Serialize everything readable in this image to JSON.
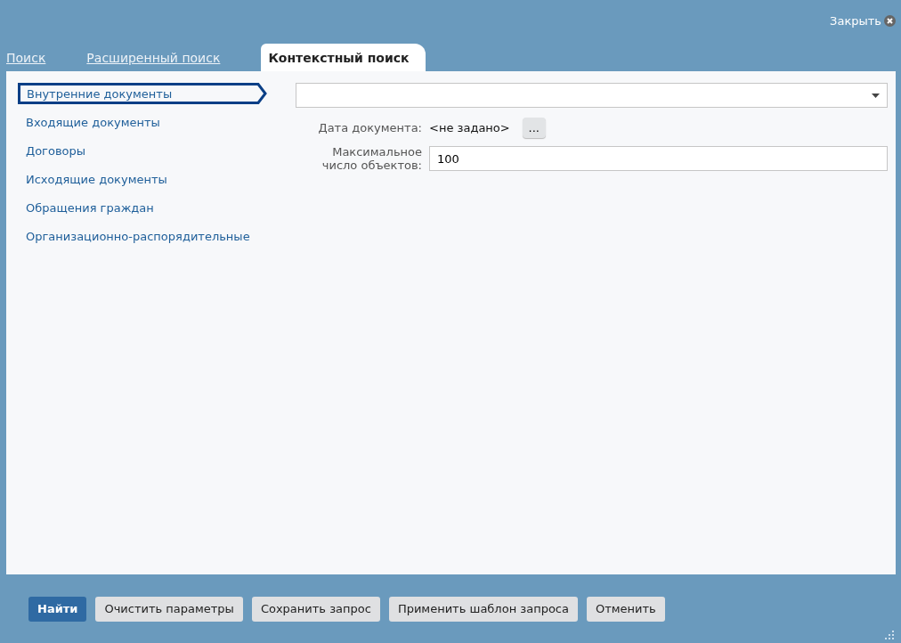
{
  "header": {
    "close_label": "Закрыть"
  },
  "tabs": [
    {
      "label": "Поиск",
      "selected": false
    },
    {
      "label": "Расширенный поиск",
      "selected": false
    },
    {
      "label": "Контекстный поиск",
      "selected": true
    }
  ],
  "sidebar": {
    "items": [
      {
        "label": "Внутренние документы",
        "selected": true
      },
      {
        "label": "Входящие документы",
        "selected": false
      },
      {
        "label": "Договоры",
        "selected": false
      },
      {
        "label": "Исходящие документы",
        "selected": false
      },
      {
        "label": "Обращения граждан",
        "selected": false
      },
      {
        "label": "Организационно-распорядительные",
        "selected": false
      }
    ]
  },
  "form": {
    "fields": [
      {
        "kind": "date",
        "label": "Дата документа:",
        "value": "<не задано>",
        "button": "..."
      },
      {
        "kind": "input",
        "label": "Максимальное число объектов:",
        "value": "100"
      }
    ]
  },
  "buttons": [
    {
      "label": "Найти",
      "kind": "primary"
    },
    {
      "label": "Очистить параметры",
      "kind": "default"
    },
    {
      "label": "Сохранить запрос",
      "kind": "default"
    },
    {
      "label": "Применить шаблон запроса",
      "kind": "default"
    },
    {
      "label": "Отменить",
      "kind": "default"
    }
  ]
}
